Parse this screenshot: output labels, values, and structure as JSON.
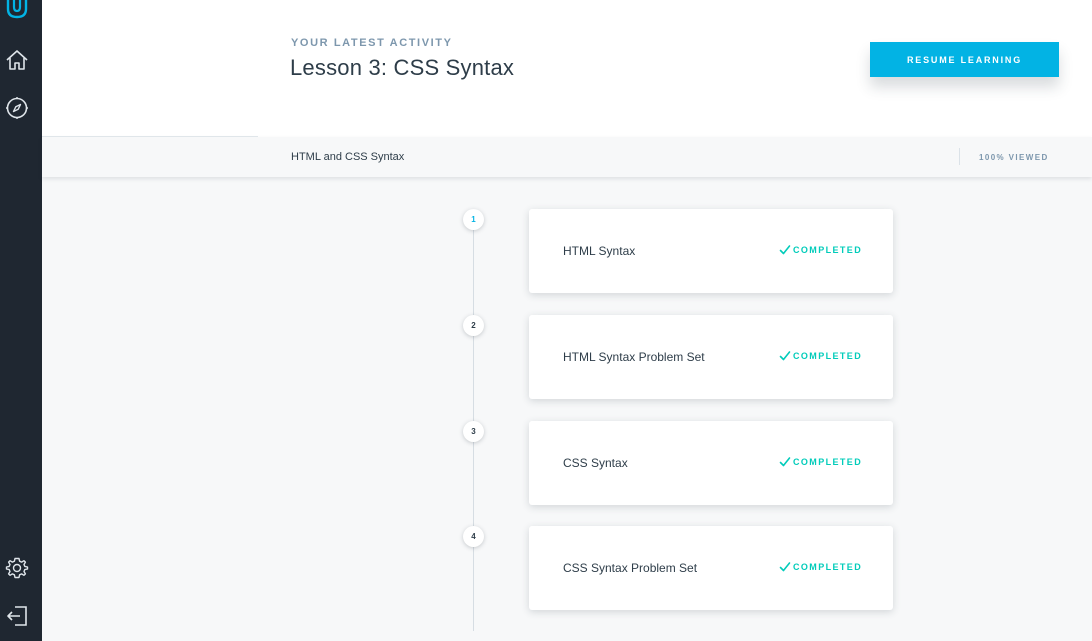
{
  "header": {
    "eyebrow": "YOUR LATEST ACTIVITY",
    "lesson_title": "Lesson 3: CSS Syntax",
    "resume_label": "RESUME LEARNING"
  },
  "subbar": {
    "concept_title": "HTML and CSS Syntax",
    "progress_label": "100% VIEWED"
  },
  "sidebar": {
    "icons": [
      "udacity-logo-icon",
      "home-icon",
      "compass-icon",
      "settings-gear-icon",
      "logout-icon"
    ]
  },
  "steps": [
    {
      "number": "1",
      "title": "HTML Syntax",
      "status": "COMPLETED"
    },
    {
      "number": "2",
      "title": "HTML Syntax Problem Set",
      "status": "COMPLETED"
    },
    {
      "number": "3",
      "title": "CSS Syntax",
      "status": "COMPLETED"
    },
    {
      "number": "4",
      "title": "CSS Syntax Problem Set",
      "status": "COMPLETED"
    }
  ],
  "colors": {
    "accent": "#02b3e4",
    "sidebar": "#1f2731",
    "completed": "#02ccba"
  }
}
